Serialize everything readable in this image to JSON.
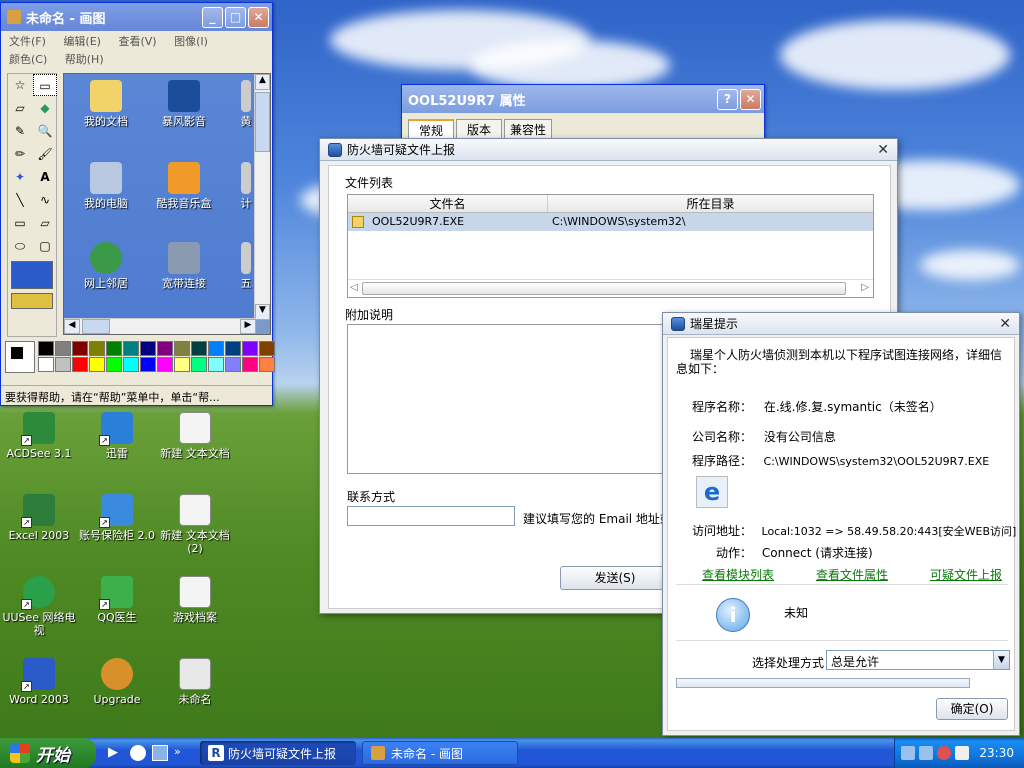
{
  "desktop_icons": [
    {
      "label": "ACDSee 3.1",
      "icon": "acdsee-icon",
      "color": "#2c8a3a"
    },
    {
      "label": "迅雷",
      "icon": "thunder-icon",
      "color": "#2a7fd8"
    },
    {
      "label": "新建 文本文档",
      "icon": "text-doc-icon",
      "color": "#f4f4f4"
    },
    {
      "label": "Excel 2003",
      "icon": "excel-icon",
      "color": "#2d7d3a"
    },
    {
      "label": "账号保险柜 2.0",
      "icon": "safe-icon",
      "color": "#3a8ae0"
    },
    {
      "label": "新建 文本文档 (2)",
      "icon": "text-doc-icon",
      "color": "#f4f4f4"
    },
    {
      "label": "UUSee 网络电视",
      "icon": "uusee-icon",
      "color": "#2aa04a"
    },
    {
      "label": "QQ医生",
      "icon": "qq-doctor-icon",
      "color": "#3cb04a"
    },
    {
      "label": "游戏档案",
      "icon": "text-doc-icon",
      "color": "#f4f4f4"
    },
    {
      "label": "Word 2003",
      "icon": "word-icon",
      "color": "#2a5bc8"
    },
    {
      "label": "Upgrade",
      "icon": "upgrade-icon",
      "color": "#d8902a"
    },
    {
      "label": "未命名",
      "icon": "bitmap-icon",
      "color": "#e8e8e8"
    }
  ],
  "paint": {
    "title": "未命名 - 画图",
    "menu": [
      "文件(F)",
      "编辑(E)",
      "查看(V)",
      "图像(I)",
      "颜色(C)",
      "帮助(H)"
    ],
    "canvas_icons": [
      {
        "label": "我的文档",
        "icon": "folder-icon"
      },
      {
        "label": "暴风影音",
        "icon": "media-player-icon"
      },
      {
        "label": "黄",
        "icon": "cropped-icon"
      },
      {
        "label": "我的电脑",
        "icon": "computer-icon"
      },
      {
        "label": "酷我音乐盒",
        "icon": "music-box-icon"
      },
      {
        "label": "计",
        "icon": "cropped-icon"
      },
      {
        "label": "网上邻居",
        "icon": "network-icon"
      },
      {
        "label": "宽带连接",
        "icon": "broadband-icon"
      },
      {
        "label": "五",
        "icon": "cropped-icon"
      }
    ],
    "status": "要获得帮助，请在“帮助”菜单中，单击“帮...",
    "palette": [
      "#000000",
      "#808080",
      "#800000",
      "#808000",
      "#008000",
      "#008080",
      "#000080",
      "#800080",
      "#808040",
      "#004040",
      "#0080ff",
      "#004080",
      "#8000ff",
      "#804000",
      "#ffffff",
      "#c0c0c0",
      "#ff0000",
      "#ffff00",
      "#00ff00",
      "#00ffff",
      "#0000ff",
      "#ff00ff",
      "#ffff80",
      "#00ff80",
      "#80ffff",
      "#8080ff",
      "#ff0080",
      "#ff8040"
    ]
  },
  "props": {
    "title": "OOL52U9R7 属性",
    "tabs": [
      "常规",
      "版本",
      "兼容性"
    ]
  },
  "upload": {
    "title": "防火墙可疑文件上报",
    "file_list_label": "文件列表",
    "col_name": "文件名",
    "col_dir": "所在目录",
    "row_name": "OOL52U9R7.EXE",
    "row_dir": "C:\\WINDOWS\\system32\\",
    "note_label": "附加说明",
    "contact_label": "联系方式",
    "contact_hint": "建议填写您的 Email 地址或",
    "send_label": "发送(S)"
  },
  "alert": {
    "title": "瑞星提示",
    "message": "瑞星个人防火墙侦测到本机以下程序试图连接网络，详细信息如下：",
    "prog_name_label": "程序名称：",
    "prog_name_value": "在.线.修.复.symantic（未签名）",
    "company_label": "公司名称：",
    "company_value": "没有公司信息",
    "path_label": "程序路径：",
    "path_value": "C:\\WINDOWS\\system32\\OOL52U9R7.EXE",
    "addr_label": "访问地址：",
    "addr_value": "Local:1032 => 58.49.58.20:443[安全WEB访问]",
    "action_label": "动作：",
    "action_value": "Connect (请求连接)",
    "links": [
      "查看模块列表",
      "查看文件属性",
      "可疑文件上报"
    ],
    "info_text": "未知",
    "handle_label": "选择处理方式",
    "handle_value": "总是允许",
    "ok_label": "确定(O)"
  },
  "taskbar": {
    "start_label": "开始",
    "tasks": [
      "防火墙可疑文件上报",
      "未命名 - 画图"
    ],
    "clock": "23:30"
  }
}
